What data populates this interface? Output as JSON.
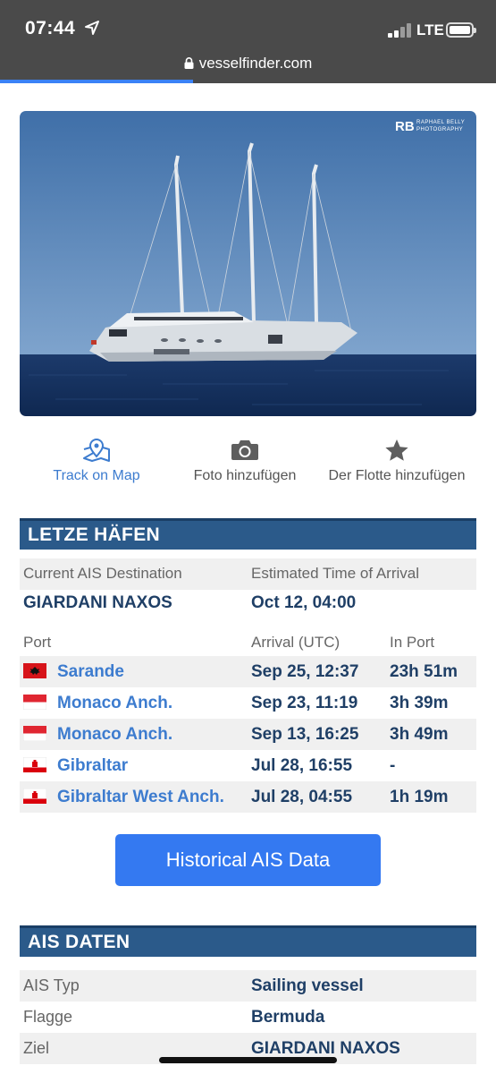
{
  "status_bar": {
    "time": "07:44",
    "network": "LTE"
  },
  "browser": {
    "url": "vesselfinder.com",
    "load_progress_fraction": 0.39
  },
  "hero": {
    "watermark_mark": "RB",
    "watermark_name": "RAPHAEL BELLY",
    "watermark_sub": "PHOTOGRAPHY"
  },
  "actions": [
    {
      "label": "Track on Map",
      "icon": "map-pin-icon"
    },
    {
      "label": "Foto hinzufügen",
      "icon": "camera-icon"
    },
    {
      "label": "Der Flotte hinzufügen",
      "icon": "star-icon"
    }
  ],
  "ports_section": {
    "title": "LETZE HÄFEN",
    "destination_header": "Current AIS Destination",
    "eta_header": "Estimated Time of Arrival",
    "destination": "GIARDANI NAXOS",
    "eta": "Oct 12, 04:00",
    "columns": [
      "Port",
      "Arrival (UTC)",
      "In Port"
    ],
    "rows": [
      {
        "flag": "albania",
        "port": "Sarande",
        "arrival": "Sep 25, 12:37",
        "in_port": "23h 51m"
      },
      {
        "flag": "monaco",
        "port": "Monaco Anch.",
        "arrival": "Sep 23, 11:19",
        "in_port": "3h 39m"
      },
      {
        "flag": "monaco",
        "port": "Monaco Anch.",
        "arrival": "Sep 13, 16:25",
        "in_port": "3h 49m"
      },
      {
        "flag": "gibraltar",
        "port": "Gibraltar",
        "arrival": "Jul 28, 16:55",
        "in_port": "-"
      },
      {
        "flag": "gibraltar",
        "port": "Gibraltar West Anch.",
        "arrival": "Jul 28, 04:55",
        "in_port": "1h 19m"
      }
    ],
    "button_label": "Historical AIS Data"
  },
  "ais_section": {
    "title": "AIS DATEN",
    "rows": [
      {
        "label": "AIS Typ",
        "value": "Sailing vessel"
      },
      {
        "label": "Flagge",
        "value": "Bermuda"
      },
      {
        "label": "Ziel",
        "value": "GIARDANI NAXOS"
      }
    ]
  },
  "colors": {
    "header_blue": "#2b5a8a",
    "link_blue": "#3d7ccf",
    "button_blue": "#3479f1",
    "value_navy": "#1f3f66"
  }
}
